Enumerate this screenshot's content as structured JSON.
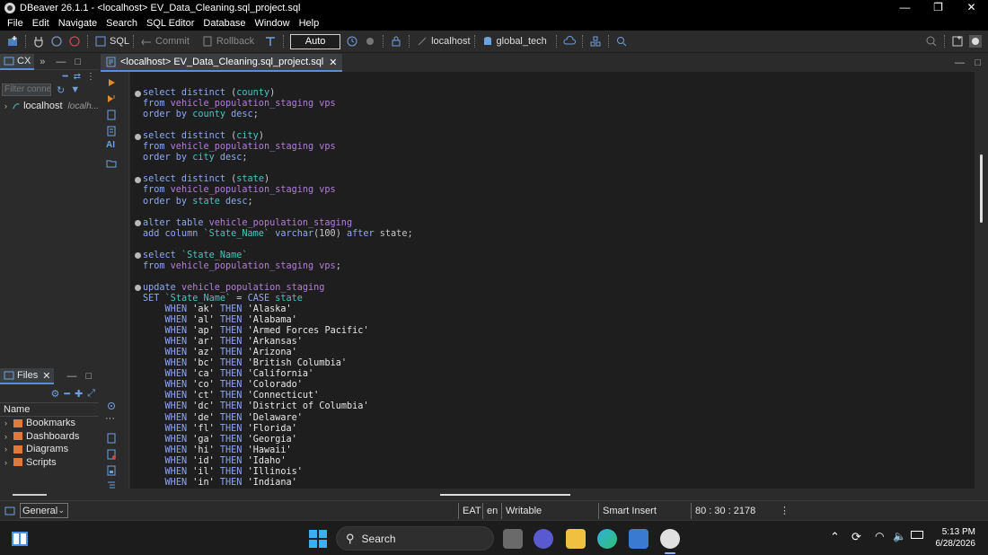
{
  "window": {
    "title": "DBeaver 26.1.1 - <localhost> EV_Data_Cleaning.sql_project.sql",
    "minimize": "—",
    "restore": "❐",
    "close": "✕"
  },
  "menu": [
    "File",
    "Edit",
    "Navigate",
    "Search",
    "SQL Editor",
    "Database",
    "Window",
    "Help"
  ],
  "toolbar": {
    "sql_label": "SQL",
    "commit_label": "Commit",
    "rollback_label": "Rollback",
    "transaction_mode": "Auto",
    "connection": "localhost",
    "database": "global_tech"
  },
  "navigator": {
    "tab_label": "CX",
    "filter_placeholder": "Filter conne",
    "items": [
      {
        "label": "localhost",
        "hint": "localh..."
      }
    ]
  },
  "files_panel": {
    "tab_label": "Files",
    "column_header": "Name",
    "items": [
      "Bookmarks",
      "Dashboards",
      "Diagrams",
      "Scripts"
    ]
  },
  "editor": {
    "tab_label": "<localhost> EV_Data_Cleaning.sql_project.sql"
  },
  "code_lines": [
    {
      "bullet": true,
      "tokens": [
        [
          "kw",
          "select distinct "
        ],
        [
          "plain",
          "("
        ],
        [
          "col",
          "county"
        ],
        [
          "plain",
          ")"
        ]
      ]
    },
    {
      "bullet": false,
      "tokens": [
        [
          "kw",
          "from "
        ],
        [
          "id",
          "vehicle_population_staging vps"
        ]
      ]
    },
    {
      "bullet": false,
      "tokens": [
        [
          "kw",
          "order by "
        ],
        [
          "col",
          "county"
        ],
        [
          "kw",
          " desc"
        ],
        [
          "plain",
          ";"
        ]
      ]
    },
    {
      "bullet": false,
      "tokens": []
    },
    {
      "bullet": true,
      "tokens": [
        [
          "kw",
          "select distinct "
        ],
        [
          "plain",
          "("
        ],
        [
          "col",
          "city"
        ],
        [
          "plain",
          ")"
        ]
      ]
    },
    {
      "bullet": false,
      "tokens": [
        [
          "kw",
          "from "
        ],
        [
          "id",
          "vehicle_population_staging vps"
        ]
      ]
    },
    {
      "bullet": false,
      "tokens": [
        [
          "kw",
          "order by "
        ],
        [
          "col",
          "city"
        ],
        [
          "kw",
          " desc"
        ],
        [
          "plain",
          ";"
        ]
      ]
    },
    {
      "bullet": false,
      "tokens": []
    },
    {
      "bullet": true,
      "tokens": [
        [
          "kw",
          "select distinct "
        ],
        [
          "plain",
          "("
        ],
        [
          "col",
          "state"
        ],
        [
          "plain",
          ")"
        ]
      ]
    },
    {
      "bullet": false,
      "tokens": [
        [
          "kw",
          "from "
        ],
        [
          "id",
          "vehicle_population_staging vps"
        ]
      ]
    },
    {
      "bullet": false,
      "tokens": [
        [
          "kw",
          "order by "
        ],
        [
          "col",
          "state"
        ],
        [
          "kw",
          " desc"
        ],
        [
          "plain",
          ";"
        ]
      ]
    },
    {
      "bullet": false,
      "tokens": []
    },
    {
      "bullet": true,
      "tokens": [
        [
          "kw",
          "alter table "
        ],
        [
          "id",
          "vehicle_population_staging"
        ]
      ]
    },
    {
      "bullet": false,
      "tokens": [
        [
          "kw",
          "add column "
        ],
        [
          "col",
          "`State_Name`"
        ],
        [
          "kw",
          " varchar"
        ],
        [
          "plain",
          "(100) "
        ],
        [
          "kw",
          "after "
        ],
        [
          "plain",
          "state;"
        ]
      ]
    },
    {
      "bullet": false,
      "tokens": []
    },
    {
      "bullet": true,
      "tokens": [
        [
          "kw",
          "select "
        ],
        [
          "col",
          "`State_Name`"
        ]
      ]
    },
    {
      "bullet": false,
      "tokens": [
        [
          "kw",
          "from "
        ],
        [
          "id",
          "vehicle_population_staging vps"
        ],
        [
          "plain",
          ";"
        ]
      ]
    },
    {
      "bullet": false,
      "tokens": []
    },
    {
      "bullet": true,
      "tokens": [
        [
          "kw",
          "update "
        ],
        [
          "id",
          "vehicle_population_staging"
        ]
      ]
    },
    {
      "bullet": false,
      "tokens": [
        [
          "kw",
          "SET "
        ],
        [
          "col",
          "`State_Name`"
        ],
        [
          "plain",
          " = "
        ],
        [
          "kw",
          "CASE "
        ],
        [
          "col",
          "state"
        ]
      ]
    },
    {
      "bullet": false,
      "tokens": [
        [
          "plain",
          "    "
        ],
        [
          "kw",
          "WHEN "
        ],
        [
          "str",
          "'ak'"
        ],
        [
          "kw",
          " THEN "
        ],
        [
          "str",
          "'Alaska'"
        ]
      ]
    },
    {
      "bullet": false,
      "tokens": [
        [
          "plain",
          "    "
        ],
        [
          "kw",
          "WHEN "
        ],
        [
          "str",
          "'al'"
        ],
        [
          "kw",
          " THEN "
        ],
        [
          "str",
          "'Alabama'"
        ]
      ]
    },
    {
      "bullet": false,
      "tokens": [
        [
          "plain",
          "    "
        ],
        [
          "kw",
          "WHEN "
        ],
        [
          "str",
          "'ap'"
        ],
        [
          "kw",
          " THEN "
        ],
        [
          "str",
          "'Armed Forces Pacific'"
        ]
      ]
    },
    {
      "bullet": false,
      "tokens": [
        [
          "plain",
          "    "
        ],
        [
          "kw",
          "WHEN "
        ],
        [
          "str",
          "'ar'"
        ],
        [
          "kw",
          " THEN "
        ],
        [
          "str",
          "'Arkansas'"
        ]
      ]
    },
    {
      "bullet": false,
      "tokens": [
        [
          "plain",
          "    "
        ],
        [
          "kw",
          "WHEN "
        ],
        [
          "str",
          "'az'"
        ],
        [
          "kw",
          " THEN "
        ],
        [
          "str",
          "'Arizona'"
        ]
      ]
    },
    {
      "bullet": false,
      "tokens": [
        [
          "plain",
          "    "
        ],
        [
          "kw",
          "WHEN "
        ],
        [
          "str",
          "'bc'"
        ],
        [
          "kw",
          " THEN "
        ],
        [
          "str",
          "'British Columbia'"
        ]
      ]
    },
    {
      "bullet": false,
      "tokens": [
        [
          "plain",
          "    "
        ],
        [
          "kw",
          "WHEN "
        ],
        [
          "str",
          "'ca'"
        ],
        [
          "kw",
          " THEN "
        ],
        [
          "str",
          "'California'"
        ]
      ]
    },
    {
      "bullet": false,
      "tokens": [
        [
          "plain",
          "    "
        ],
        [
          "kw",
          "WHEN "
        ],
        [
          "str",
          "'co'"
        ],
        [
          "kw",
          " THEN "
        ],
        [
          "str",
          "'Colorado'"
        ]
      ]
    },
    {
      "bullet": false,
      "tokens": [
        [
          "plain",
          "    "
        ],
        [
          "kw",
          "WHEN "
        ],
        [
          "str",
          "'ct'"
        ],
        [
          "kw",
          " THEN "
        ],
        [
          "str",
          "'Connecticut'"
        ]
      ]
    },
    {
      "bullet": false,
      "tokens": [
        [
          "plain",
          "    "
        ],
        [
          "kw",
          "WHEN "
        ],
        [
          "str",
          "'dc'"
        ],
        [
          "kw",
          " THEN "
        ],
        [
          "str",
          "'District of Columbia'"
        ]
      ]
    },
    {
      "bullet": false,
      "tokens": [
        [
          "plain",
          "    "
        ],
        [
          "kw",
          "WHEN "
        ],
        [
          "str",
          "'de'"
        ],
        [
          "kw",
          " THEN "
        ],
        [
          "str",
          "'Delaware'"
        ]
      ]
    },
    {
      "bullet": false,
      "tokens": [
        [
          "plain",
          "    "
        ],
        [
          "kw",
          "WHEN "
        ],
        [
          "str",
          "'fl'"
        ],
        [
          "kw",
          " THEN "
        ],
        [
          "str",
          "'Florida'"
        ]
      ]
    },
    {
      "bullet": false,
      "tokens": [
        [
          "plain",
          "    "
        ],
        [
          "kw",
          "WHEN "
        ],
        [
          "str",
          "'ga'"
        ],
        [
          "kw",
          " THEN "
        ],
        [
          "str",
          "'Georgia'"
        ]
      ]
    },
    {
      "bullet": false,
      "tokens": [
        [
          "plain",
          "    "
        ],
        [
          "kw",
          "WHEN "
        ],
        [
          "str",
          "'hi'"
        ],
        [
          "kw",
          " THEN "
        ],
        [
          "str",
          "'Hawaii'"
        ]
      ]
    },
    {
      "bullet": false,
      "tokens": [
        [
          "plain",
          "    "
        ],
        [
          "kw",
          "WHEN "
        ],
        [
          "str",
          "'id'"
        ],
        [
          "kw",
          " THEN "
        ],
        [
          "str",
          "'Idaho'"
        ]
      ]
    },
    {
      "bullet": false,
      "tokens": [
        [
          "plain",
          "    "
        ],
        [
          "kw",
          "WHEN "
        ],
        [
          "str",
          "'il'"
        ],
        [
          "kw",
          " THEN "
        ],
        [
          "str",
          "'Illinois'"
        ]
      ]
    },
    {
      "bullet": false,
      "tokens": [
        [
          "plain",
          "    "
        ],
        [
          "kw",
          "WHEN "
        ],
        [
          "str",
          "'in'"
        ],
        [
          "kw",
          " THEN "
        ],
        [
          "str",
          "'Indiana'"
        ]
      ]
    }
  ],
  "statusbar": {
    "perspective": "General",
    "timezone": "EAT",
    "locale": "en",
    "mode": "Writable",
    "insert_mode": "Smart Insert",
    "cursor": "80 : 30 : 2178"
  },
  "taskbar": {
    "search_label": "Search",
    "time": "5:13 PM",
    "date": "6/28/2026"
  }
}
